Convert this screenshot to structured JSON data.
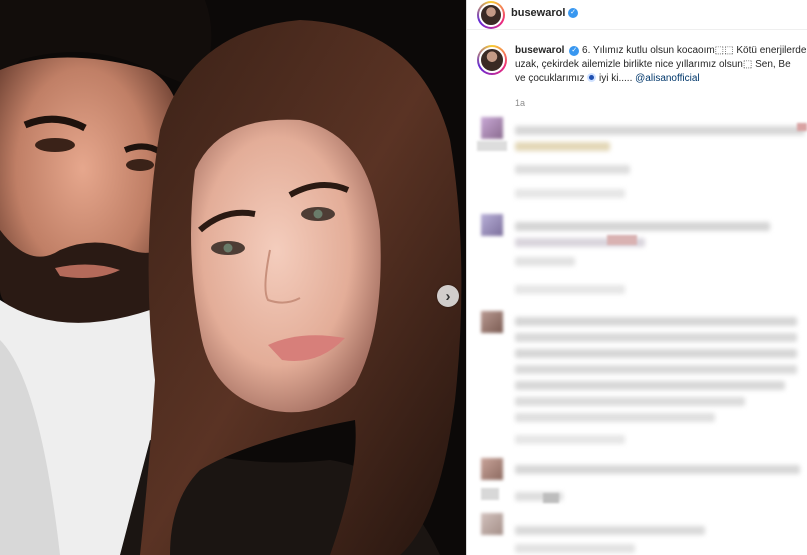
{
  "post": {
    "username": "busewarol",
    "verified_mark": "✓",
    "caption_line1": "6. Yılımız kutlu olsun kocaoım⬚⬚ Kötü enerjilerde",
    "caption_line2": "uzak, çekirdek ailemizle birlikte nice yıllarımız olsun⬚ Sen, Be",
    "caption_line3_pre": "ve çocuklarımız",
    "caption_line3_mid": " iyi ki..... ",
    "mention": "@alisanofficial",
    "time_ago": "1a"
  },
  "photo": {
    "next_icon": "chevron-right-icon",
    "next_glyph": "›"
  },
  "colors": {
    "link": "#00376b",
    "verified": "#3897f0",
    "muted": "#8e8e8e"
  }
}
